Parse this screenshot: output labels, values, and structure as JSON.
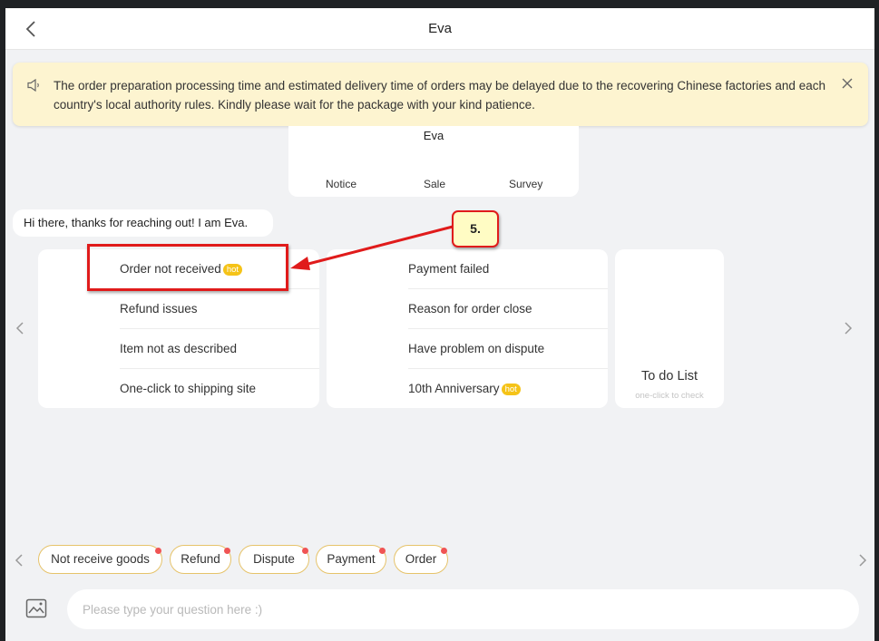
{
  "header": {
    "title": "Eva"
  },
  "notice": {
    "text": "The order preparation processing time and estimated delivery time of orders may be delayed due to the recovering Chinese factories and each country's local authority rules. Kindly please wait for the package with your kind patience."
  },
  "profile": {
    "name": "Eva",
    "tabs": [
      "Notice",
      "Sale",
      "Survey"
    ]
  },
  "greeting": "Hi there, thanks for reaching out! I am Eva.",
  "cards": [
    {
      "items": [
        {
          "label": "Order not received",
          "badge": "hot"
        },
        {
          "label": "Refund issues"
        },
        {
          "label": "Item not as described"
        },
        {
          "label": "One-click to shipping site"
        }
      ]
    },
    {
      "items": [
        {
          "label": "Payment failed"
        },
        {
          "label": "Reason for order close"
        },
        {
          "label": "Have problem on dispute"
        },
        {
          "label": "10th Anniversary",
          "badge": "hot"
        }
      ]
    }
  ],
  "todo": {
    "title": "To do List",
    "subtitle": "one-click to check"
  },
  "annotation": {
    "callout_label": "5.",
    "color": "#e01b1b"
  },
  "chips": [
    "Not receive goods",
    "Refund",
    "Dispute",
    "Payment",
    "Order"
  ],
  "input": {
    "placeholder": "Please type your question here :)",
    "value": ""
  },
  "colors": {
    "hot_badge": "#f5c318",
    "notice_bg": "#fdf4d0",
    "chip_border": "#e6c36a",
    "chip_dot": "#f05454"
  }
}
